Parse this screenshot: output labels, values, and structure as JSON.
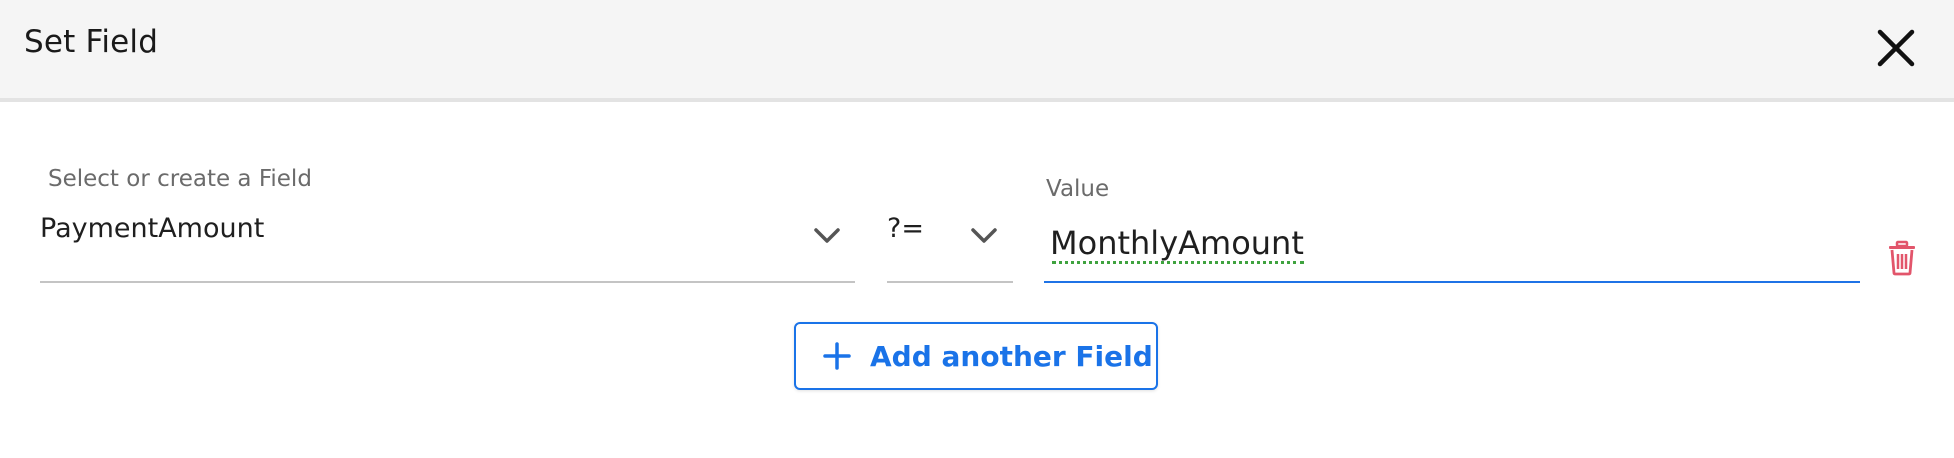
{
  "dialog": {
    "title": "Set Field",
    "close_icon": "close-icon"
  },
  "field": {
    "label": "Select or create a Field",
    "selected": "PaymentAmount",
    "icon": "chevron-down-icon"
  },
  "operator": {
    "selected": "?=",
    "icon": "chevron-down-icon"
  },
  "value": {
    "label": "Value",
    "current": "MonthlyAmount"
  },
  "delete": {
    "icon": "trash-icon",
    "color": "#e2556b"
  },
  "add_field": {
    "label": "Add another Field",
    "icon": "plus-icon"
  },
  "colors": {
    "accent": "#1a73e8",
    "header_bg": "#f5f5f5",
    "danger": "#e2556b",
    "spellcheck": "#3fa33f"
  }
}
